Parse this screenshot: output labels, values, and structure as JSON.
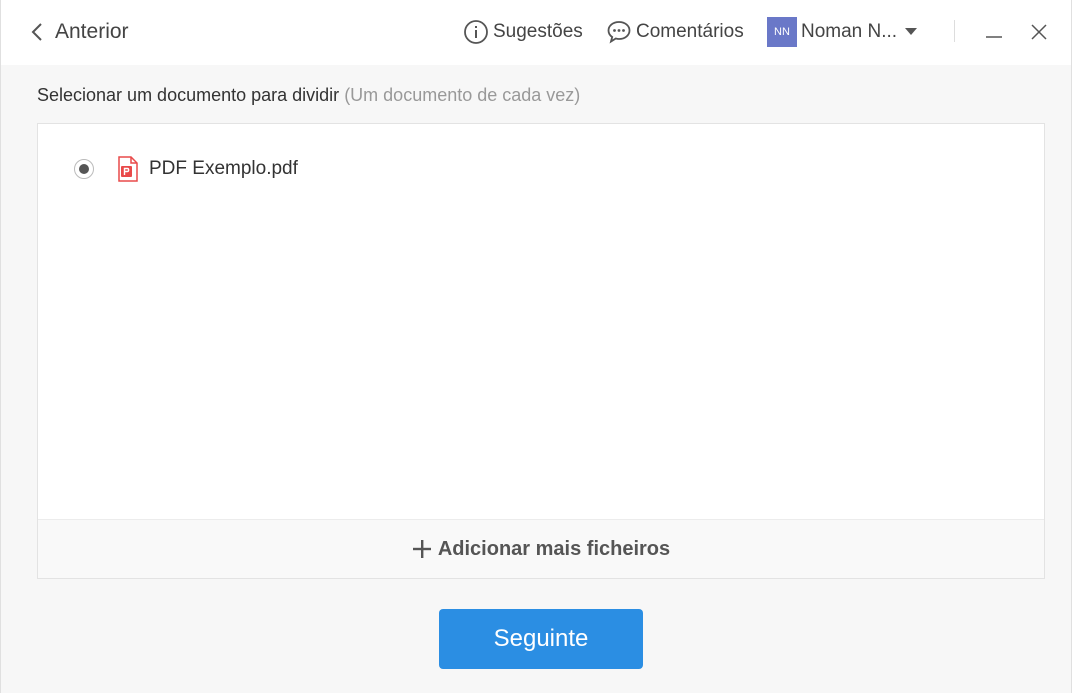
{
  "header": {
    "back_label": "Anterior",
    "suggestions_label": "Sugestões",
    "comments_label": "Comentários",
    "user": {
      "initials": "NN",
      "name": "Noman N...",
      "avatar_color": "#6a78c8"
    }
  },
  "main": {
    "instruction": "Selecionar um documento para dividir",
    "instruction_hint": "(Um documento de cada vez)",
    "files": [
      {
        "name": "PDF Exemplo.pdf",
        "selected": true,
        "icon": "pdf-file-icon"
      }
    ],
    "add_files_label": "Adicionar mais ficheiros",
    "next_label": "Seguinte"
  },
  "colors": {
    "accent": "#2b8ee3",
    "pdf_red": "#e94a4a"
  }
}
